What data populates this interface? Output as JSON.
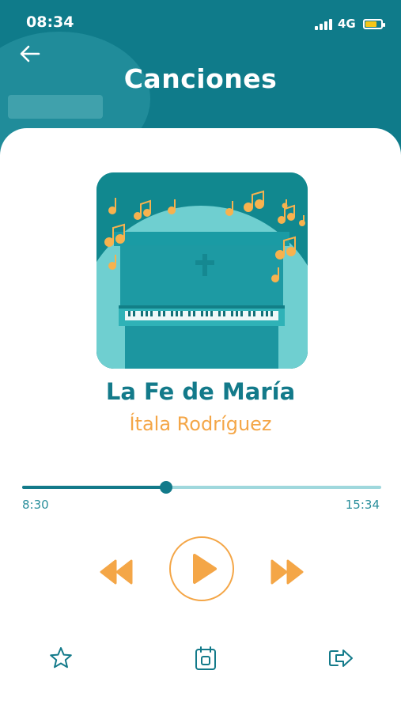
{
  "status_bar": {
    "time": "08:34",
    "network": "4G"
  },
  "header": {
    "title": "Canciones",
    "back_icon": "arrow-left-icon"
  },
  "song": {
    "title": "La Fe de María",
    "artist": "Ítala Rodríguez"
  },
  "player": {
    "elapsed": "8:30",
    "total": "15:34",
    "progress": 0.4
  },
  "controls": [
    "rewind-icon",
    "play-icon",
    "fast-forward-icon"
  ],
  "bottom_actions": [
    "star-icon",
    "calendar-icon",
    "share-icon"
  ],
  "colors": {
    "primary": "#0f7b8a",
    "accent": "#f4a647",
    "track": "#9fd8dd"
  }
}
